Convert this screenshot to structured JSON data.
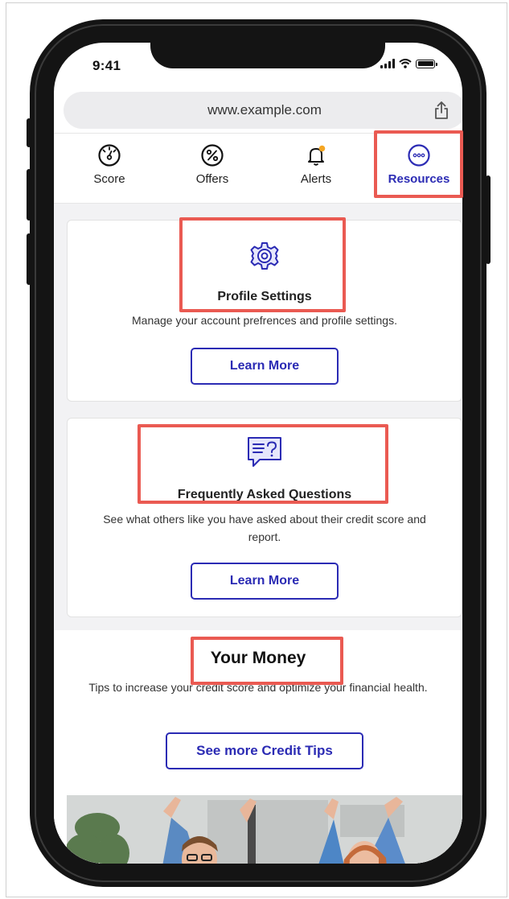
{
  "status_bar": {
    "time": "9:41"
  },
  "browser": {
    "url": "www.example.com"
  },
  "nav": {
    "items": [
      {
        "label": "Score",
        "icon": "gauge-icon"
      },
      {
        "label": "Offers",
        "icon": "percent-icon"
      },
      {
        "label": "Alerts",
        "icon": "bell-icon"
      },
      {
        "label": "Resources",
        "icon": "more-dots-icon",
        "active": true
      }
    ]
  },
  "cards": [
    {
      "title": "Profile Settings",
      "description": "Manage your account prefrences and profile settings.",
      "button": "Learn More",
      "icon": "gear-icon"
    },
    {
      "title": "Frequently Asked Questions",
      "description": "See what others like you have asked about their credit score and report.",
      "button": "Learn More",
      "icon": "faq-chat-icon"
    }
  ],
  "your_money": {
    "title": "Your Money",
    "description": "Tips to increase your credit score and optimize your financial health.",
    "button": "See more Credit Tips"
  },
  "colors": {
    "accent": "#2b2bb4",
    "highlight": "#ea5a52",
    "badge": "#f5a623"
  }
}
